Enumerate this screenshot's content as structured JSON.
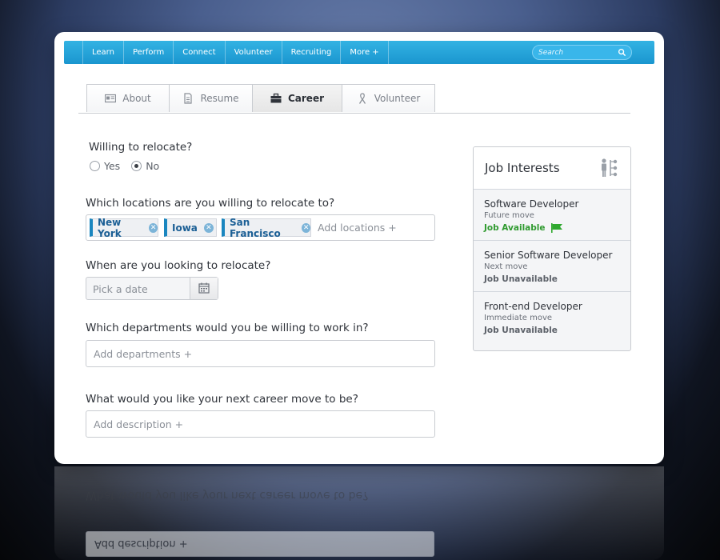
{
  "nav": {
    "items": [
      "Learn",
      "Perform",
      "Connect",
      "Volunteer",
      "Recruiting",
      "More +"
    ],
    "search_placeholder": "Search"
  },
  "tabs": [
    {
      "label": "About",
      "icon": "id-card-icon",
      "active": false
    },
    {
      "label": "Resume",
      "icon": "document-icon",
      "active": false
    },
    {
      "label": "Career",
      "icon": "briefcase-icon",
      "active": true
    },
    {
      "label": "Volunteer",
      "icon": "ribbon-icon",
      "active": false
    }
  ],
  "form": {
    "relocate_question": "Willing to relocate?",
    "relocate_options": [
      "Yes",
      "No"
    ],
    "relocate_selected": "No",
    "locations_question": "Which locations are you willing to relocate to?",
    "locations": [
      "New York",
      "Iowa",
      "San Francisco"
    ],
    "locations_add": "Add locations +",
    "when_question": "When are you looking to relocate?",
    "date_placeholder": "Pick a date",
    "departments_question": "Which departments would you be willing to work in?",
    "departments_placeholder": "Add departments +",
    "career_question": "What would you like your next career move to be?",
    "career_placeholder": "Add description +"
  },
  "jobs": {
    "title": "Job Interests",
    "items": [
      {
        "title": "Software Developer",
        "subtitle": "Future move",
        "status": "Job Available",
        "available": true
      },
      {
        "title": "Senior Software Developer",
        "subtitle": "Next move",
        "status": "Job Unavailable",
        "available": false
      },
      {
        "title": "Front-end Developer",
        "subtitle": "Immediate move",
        "status": "Job Unavailable",
        "available": false
      }
    ]
  },
  "colors": {
    "nav_blue": "#1a96cf",
    "chip_accent": "#1a86bf",
    "available_green": "#2f9a2f"
  }
}
